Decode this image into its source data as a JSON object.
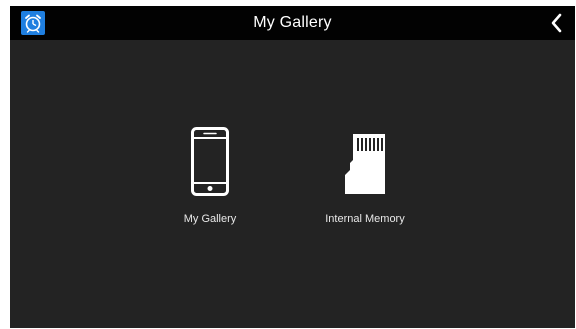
{
  "header": {
    "title": "My Gallery",
    "app_icon": "alarm-clock-icon",
    "back_icon": "chevron-left-icon"
  },
  "main": {
    "items": [
      {
        "label": "My Gallery",
        "icon": "smartphone-icon"
      },
      {
        "label": "Internal Memory",
        "icon": "sd-card-icon"
      }
    ]
  },
  "colors": {
    "background": "#232323",
    "titlebar": "#020202",
    "app_icon_bg": "#1f7fe0",
    "text": "#ffffff"
  }
}
